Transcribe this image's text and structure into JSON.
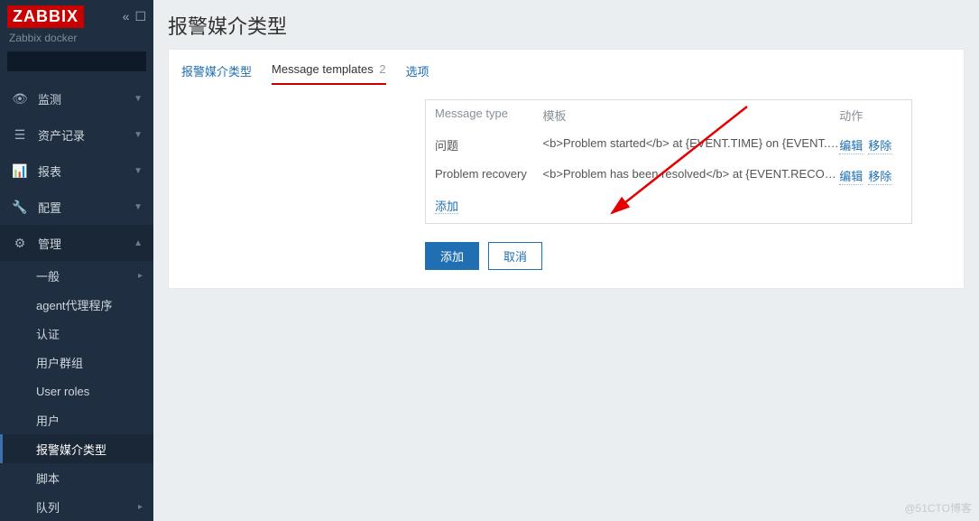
{
  "brand": {
    "logo": "ZABBIX",
    "server_name": "Zabbix docker"
  },
  "search": {
    "placeholder": ""
  },
  "nav": {
    "items": [
      {
        "icon": "eye",
        "label": "监测"
      },
      {
        "icon": "list",
        "label": "资产记录"
      },
      {
        "icon": "chart",
        "label": "报表"
      },
      {
        "icon": "wrench",
        "label": "配置"
      },
      {
        "icon": "gear",
        "label": "管理"
      }
    ],
    "sub_admin": [
      {
        "label": "一般",
        "has_chev": true
      },
      {
        "label": "agent代理程序"
      },
      {
        "label": "认证"
      },
      {
        "label": "用户群组"
      },
      {
        "label": "User roles"
      },
      {
        "label": "用户"
      },
      {
        "label": "报警媒介类型",
        "selected": true
      },
      {
        "label": "脚本"
      },
      {
        "label": "队列",
        "has_chev": true
      }
    ]
  },
  "page": {
    "title": "报警媒介类型",
    "tabs": [
      {
        "label": "报警媒介类型"
      },
      {
        "label": "Message templates",
        "count": "2",
        "active": true
      },
      {
        "label": "选项"
      }
    ],
    "table": {
      "headers": {
        "type": "Message type",
        "template": "模板",
        "action": "动作"
      },
      "rows": [
        {
          "type": "问题",
          "template": "<b>Problem started</b> at {EVENT.TIME} on {EVENT.DATE...",
          "edit": "编辑",
          "remove": "移除"
        },
        {
          "type": "Problem recovery",
          "template": "<b>Problem has been resolved</b> at {EVENT.RECOVERY...",
          "edit": "编辑",
          "remove": "移除"
        }
      ],
      "add_link": "添加"
    },
    "buttons": {
      "add": "添加",
      "cancel": "取消"
    }
  },
  "watermark": "@51CTO博客"
}
